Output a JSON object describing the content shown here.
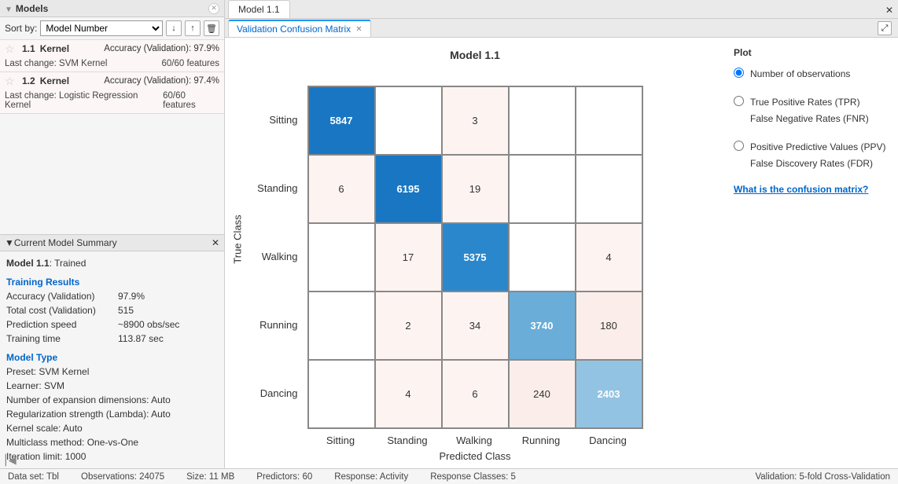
{
  "panels": {
    "models_title": "Models",
    "summary_title": "Current Model Summary"
  },
  "sort": {
    "label": "Sort by:",
    "selected": "Model Number"
  },
  "models": [
    {
      "num": "1.1",
      "name": "Kernel",
      "acc_label": "Accuracy (Validation):",
      "acc": "97.9%",
      "change_label": "Last change:",
      "change": "SVM Kernel",
      "features": "60/60 features"
    },
    {
      "num": "1.2",
      "name": "Kernel",
      "acc_label": "Accuracy (Validation):",
      "acc": "97.4%",
      "change_label": "Last change:",
      "change": "Logistic Regression Kernel",
      "features": "60/60 features"
    }
  ],
  "summary": {
    "title_line": {
      "model": "Model 1.1",
      "state": ": Trained"
    },
    "training_header": "Training Results",
    "training": [
      {
        "k": "Accuracy (Validation)",
        "v": "97.9%"
      },
      {
        "k": "Total cost (Validation)",
        "v": "515"
      },
      {
        "k": "Prediction speed",
        "v": "~8900 obs/sec"
      },
      {
        "k": "Training time",
        "v": "113.87 sec"
      }
    ],
    "modeltype_header": "Model Type",
    "modeltype": [
      "Preset: SVM Kernel",
      "Learner: SVM",
      "Number of expansion dimensions: Auto",
      "Regularization strength (Lambda): Auto",
      "Kernel scale: Auto",
      "Multiclass method: One-vs-One",
      "Iteration limit: 1000"
    ]
  },
  "tabs": {
    "main": "Model 1.1",
    "sub": "Validation Confusion Matrix"
  },
  "chart_data": {
    "type": "heatmap",
    "title": "Model 1.1",
    "xlabel": "Predicted Class",
    "ylabel": "True Class",
    "categories": [
      "Sitting",
      "Standing",
      "Walking",
      "Running",
      "Dancing"
    ],
    "matrix": [
      [
        5847,
        null,
        3,
        null,
        null
      ],
      [
        6,
        6195,
        19,
        null,
        null
      ],
      [
        null,
        17,
        5375,
        null,
        4
      ],
      [
        null,
        2,
        34,
        3740,
        180
      ],
      [
        null,
        4,
        6,
        240,
        2403
      ]
    ],
    "colors": [
      [
        "#1976c2",
        "#ffffff",
        "#fdf4f2",
        "#ffffff",
        "#ffffff"
      ],
      [
        "#fdf4f2",
        "#1976c2",
        "#fdf4f2",
        "#ffffff",
        "#ffffff"
      ],
      [
        "#ffffff",
        "#fdf4f2",
        "#2b87cc",
        "#ffffff",
        "#fdf4f2"
      ],
      [
        "#ffffff",
        "#fdf4f2",
        "#fdf4f2",
        "#6aadd8",
        "#fbeeea"
      ],
      [
        "#ffffff",
        "#fdf4f2",
        "#fdf4f2",
        "#fbeeea",
        "#93c3e2"
      ]
    ]
  },
  "plot": {
    "header": "Plot",
    "opt1": "Number of observations",
    "opt2a": "True Positive Rates (TPR)",
    "opt2b": "False Negative Rates (FNR)",
    "opt3a": "Positive Predictive Values (PPV)",
    "opt3b": "False Discovery Rates (FDR)",
    "link": "What is the confusion matrix?"
  },
  "status": {
    "dataset": "Data set: Tbl",
    "obs": "Observations: 24075",
    "size": "Size: 11 MB",
    "pred": "Predictors: 60",
    "resp": "Response: Activity",
    "respc": "Response Classes: 5",
    "val": "Validation: 5-fold Cross-Validation"
  }
}
